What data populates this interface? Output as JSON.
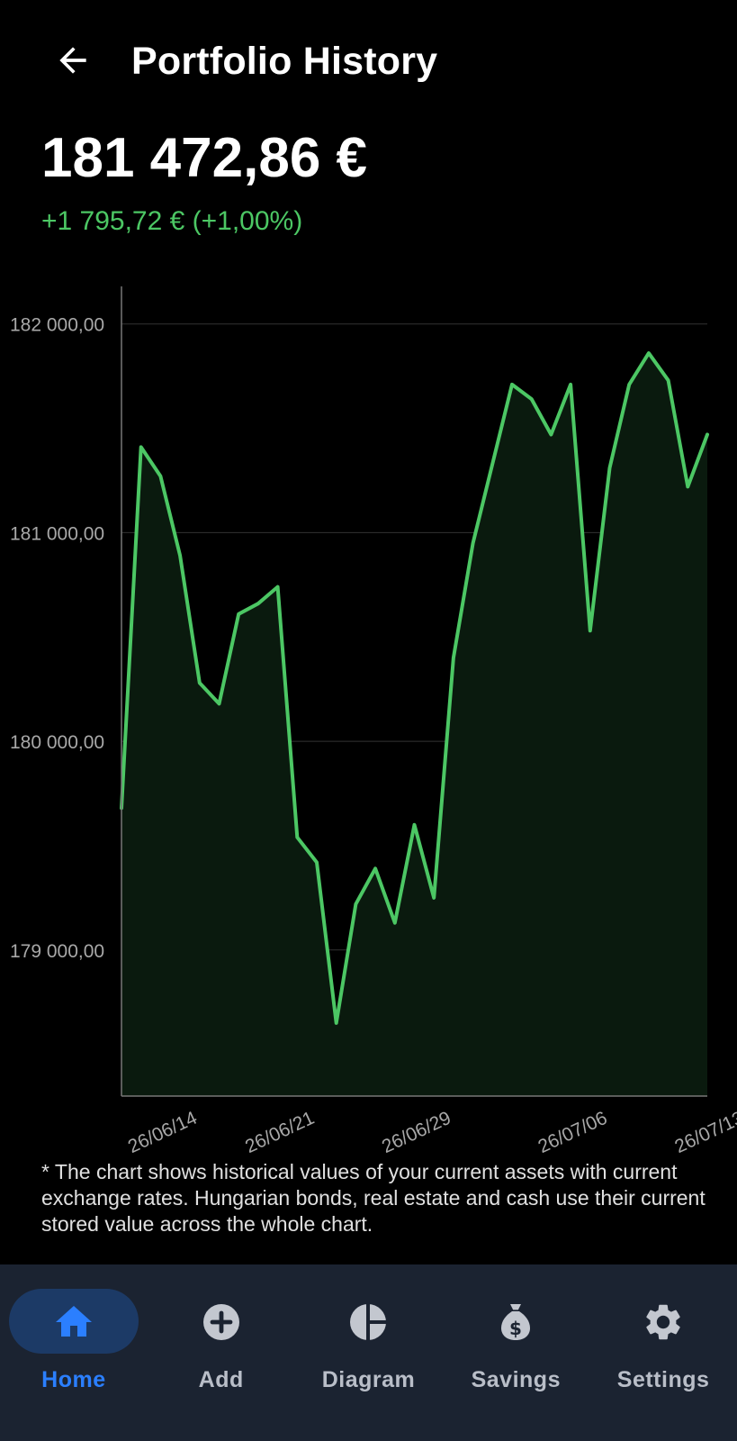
{
  "header": {
    "title": "Portfolio History"
  },
  "summary": {
    "total": "181 472,86 €",
    "change": "+1 795,72 € (+1,00%)"
  },
  "colors": {
    "positive": "#4cc764",
    "accent": "#2b7fff",
    "nav_bg": "#1b2331"
  },
  "chart_data": {
    "type": "area",
    "x": [
      "26/06/12",
      "26/06/13",
      "26/06/14",
      "26/06/15",
      "26/06/16",
      "26/06/17",
      "26/06/18",
      "26/06/19",
      "26/06/20",
      "26/06/21",
      "26/06/22",
      "26/06/23",
      "26/06/24",
      "26/06/25",
      "26/06/26",
      "26/06/27",
      "26/06/28",
      "26/06/29",
      "26/06/30",
      "26/07/01",
      "26/07/02",
      "26/07/03",
      "26/07/04",
      "26/07/05",
      "26/07/06",
      "26/07/07",
      "26/07/08",
      "26/07/09",
      "26/07/10",
      "26/07/11",
      "26/07/12",
      "26/07/13",
      "26/07/14"
    ],
    "series": [
      {
        "values": [
          179680,
          181410,
          181270,
          180890,
          180280,
          180180,
          180610,
          180660,
          180740,
          179540,
          179420,
          178650,
          179220,
          179390,
          179130,
          179600,
          179250,
          180400,
          180950,
          181330,
          181710,
          181640,
          181470,
          181710,
          180530,
          181310,
          181710,
          181860,
          181730,
          181220,
          181470
        ]
      }
    ],
    "y_ticks": [
      "182 000,00",
      "181 000,00",
      "180 000,00",
      "179 000,00"
    ],
    "y_tick_values": [
      182000,
      181000,
      180000,
      179000
    ],
    "x_ticks": [
      "26/06/14",
      "26/06/21",
      "26/06/29",
      "26/07/06",
      "26/07/13"
    ],
    "x_tick_indices": [
      2,
      8,
      15,
      23,
      30
    ],
    "ylim": [
      178300,
      182180
    ],
    "grid": true
  },
  "footnote": "* The chart shows historical values of your current assets with current exchange rates. Hungarian bonds, real estate and cash use their current stored value across the whole chart.",
  "nav": {
    "items": [
      {
        "label": "Home",
        "icon": "home-icon",
        "active": true
      },
      {
        "label": "Add",
        "icon": "add-circle-icon",
        "active": false
      },
      {
        "label": "Diagram",
        "icon": "pie-chart-icon",
        "active": false
      },
      {
        "label": "Savings",
        "icon": "money-bag-icon",
        "active": false
      },
      {
        "label": "Settings",
        "icon": "gear-icon",
        "active": false
      }
    ]
  }
}
